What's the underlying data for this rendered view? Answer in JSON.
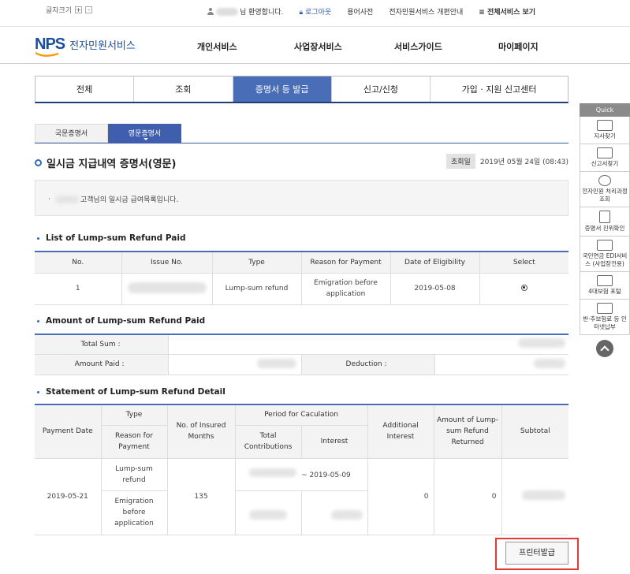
{
  "util": {
    "fontsize_label": "글자크기",
    "plus": "+",
    "minus": "-",
    "welcome_suffix": "님 환영합니다.",
    "logout": "로그아웃",
    "glossary": "용어사전",
    "reform": "전자민원서비스 개편안내",
    "all_services": "≡ 전체서비스 보기"
  },
  "header": {
    "logo": "NPS",
    "logo_text": "전자민원서비스",
    "nav": [
      "개인서비스",
      "사업장서비스",
      "서비스가이드",
      "마이페이지"
    ]
  },
  "tabs": [
    "전체",
    "조회",
    "증명서 등 발급",
    "신고/신청",
    "가입 · 지원 신고센터"
  ],
  "active_tab": 2,
  "subtabs": [
    "국문증명서",
    "영문증명서"
  ],
  "active_subtab": 1,
  "page": {
    "title": "일시금 지급내역 증명서(영문)",
    "lookup_label": "조회일",
    "lookup_date": "2019년 05월 24일 (08:43)",
    "notice": "고객님의 일시금 급여목록입니다."
  },
  "list": {
    "title": "List of Lump-sum Refund Paid",
    "headers": [
      "No.",
      "Issue No.",
      "Type",
      "Reason for Payment",
      "Date of Eligibility",
      "Select"
    ],
    "row": {
      "no": "1",
      "type": "Lump-sum refund",
      "reason": "Emigration before application",
      "date": "2019-05-08"
    }
  },
  "amount": {
    "title": "Amount of Lump-sum Refund Paid",
    "total_label": "Total Sum :",
    "paid_label": "Amount Paid :",
    "deduction_label": "Deduction :"
  },
  "detail": {
    "title": "Statement of Lump-sum Refund Detail",
    "h_payment_date": "Payment Date",
    "h_type": "Type",
    "h_reason": "Reason for Payment",
    "h_months": "No. of Insured Months",
    "h_period": "Period for Caculation",
    "h_total_contrib": "Total Contributions",
    "h_interest": "Interest",
    "h_add_interest": "Additional Interest",
    "h_returned": "Amount of Lump-sum Refund Returned",
    "h_subtotal": "Subtotal",
    "payment_date": "2019-05-21",
    "type": "Lump-sum refund",
    "reason": "Emigration before application",
    "months": "135",
    "period_end": "~ 2019-05-09",
    "add_interest": "0",
    "returned": "0"
  },
  "print_button": "프린터발급",
  "quick": {
    "head": "Quick",
    "items": [
      "지사찾기",
      "신고서찾기",
      "전자민원 처리과정 조회",
      "증명서 진위확인",
      "국민연금 EDI서비스 (사업장전용)",
      "4대보험 포털",
      "반·추보험료 등 인터넷납부"
    ]
  }
}
